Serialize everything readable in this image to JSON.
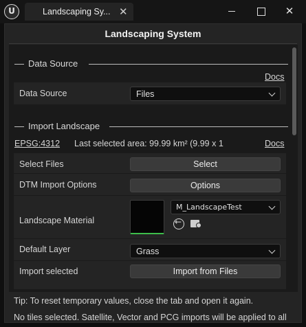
{
  "window": {
    "tab_title": "Landscaping Sy...",
    "close_glyph": "✕",
    "window_close_glyph": "✕"
  },
  "panel": {
    "title": "Landscaping System"
  },
  "data_source_section": {
    "header": "Data Source",
    "docs_link": "Docs",
    "row_label": "Data Source",
    "combo_value": "Files"
  },
  "import_section": {
    "header": "Import Landscape",
    "epsg_link": "EPSG:4312",
    "selected_area": "Last selected area: 99.99 km² (9.99 x 1",
    "docs_link": "Docs",
    "rows": {
      "select_files_label": "Select Files",
      "select_button": "Select",
      "dtm_label": "DTM Import Options",
      "options_button": "Options",
      "material_label": "Landscape Material",
      "material_value": "M_LandscapeTest",
      "default_layer_label": "Default Layer",
      "default_layer_value": "Grass",
      "import_label": "Import selected",
      "import_button": "Import from Files"
    }
  },
  "footer": {
    "tip": "Tip: To reset temporary values, close the tab and open it again.",
    "status": "No tiles selected. Satellite, Vector and PCG imports will be applied to all"
  },
  "colors": {
    "accent_green": "#3dbf4b",
    "panel_bg": "#242424",
    "dark_bg": "#1a1a1a"
  }
}
